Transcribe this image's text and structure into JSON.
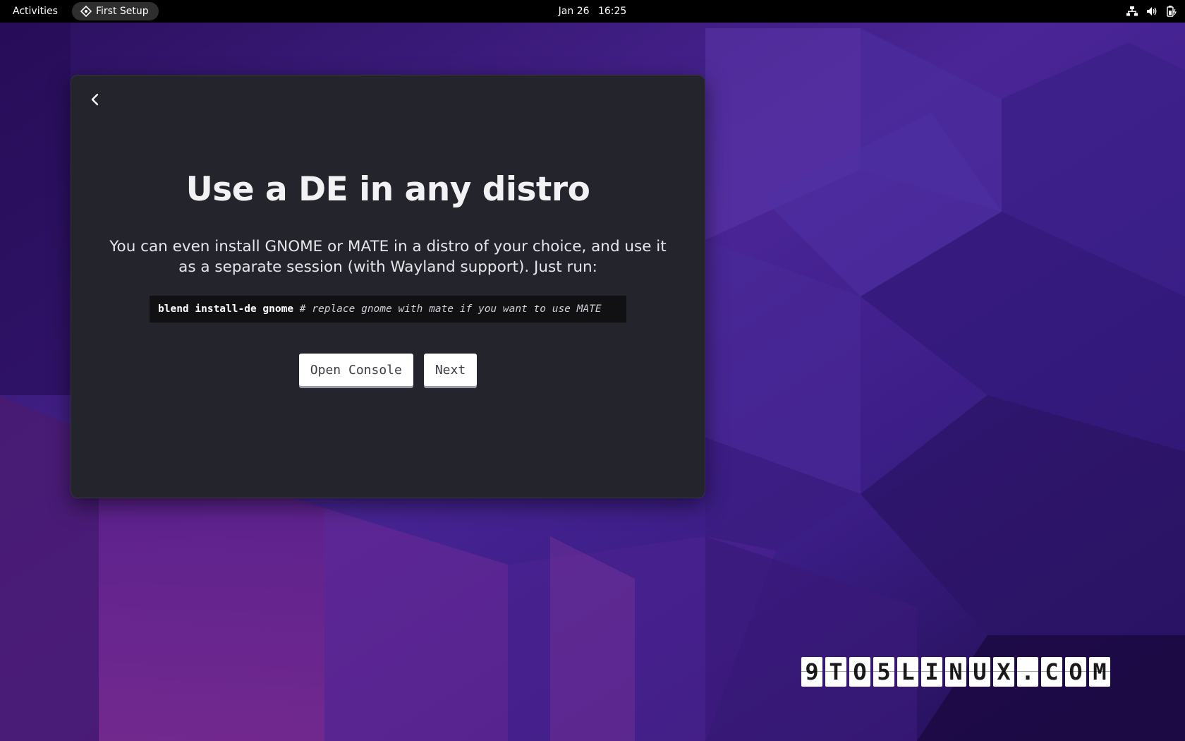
{
  "topbar": {
    "activities_label": "Activities",
    "app_name": "First Setup",
    "date": "Jan 26",
    "time": "16:25",
    "tray_icons": [
      "network-wired-icon",
      "volume-icon",
      "battery-icon"
    ]
  },
  "window": {
    "title": "Use a DE in any distro",
    "description": "You can even install GNOME or MATE in a distro of your choice, and use it as a separate session (with Wayland support). Just run:",
    "code": {
      "command": "blend install-de gnome",
      "comment": "# replace gnome with mate if you want to use MATE"
    },
    "buttons": {
      "open_console": "Open Console",
      "next": "Next"
    },
    "back_icon": "chevron-left-icon"
  },
  "watermark": {
    "text": [
      "9",
      "T",
      "O",
      "5",
      "L",
      "I",
      "N",
      "U",
      "X",
      ".",
      "C",
      "O",
      "M"
    ]
  },
  "colors": {
    "topbar_bg": "#000000",
    "window_bg": "#24242d",
    "code_bg": "#111114",
    "button_bg": "#ffffff",
    "wallpaper_base": "#3a1a7a"
  }
}
